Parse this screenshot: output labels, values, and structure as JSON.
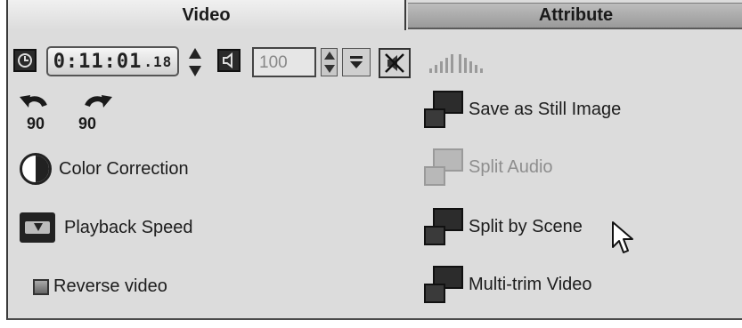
{
  "tabs": {
    "video": "Video",
    "attribute": "Attribute"
  },
  "toolbar": {
    "clock_icon": "clock-icon",
    "timecode_main": "0:11:01",
    "timecode_frames": ".18",
    "speaker_icon": "speaker-icon",
    "volume_value": "100",
    "mute_icon": "mute-icon",
    "fade_in_icon": "fade-in-icon",
    "fade_out_icon": "fade-out-icon"
  },
  "rotate": {
    "left_label": "90",
    "right_label": "90"
  },
  "left_actions": {
    "color_correction": "Color Correction",
    "playback_speed": "Playback Speed",
    "reverse_video": "Reverse video"
  },
  "right_actions": {
    "save_still": "Save as Still Image",
    "split_audio": "Split Audio",
    "split_scene": "Split by Scene",
    "multi_trim": "Multi-trim Video"
  },
  "state": {
    "reverse_checked": false,
    "split_audio_disabled": true
  }
}
